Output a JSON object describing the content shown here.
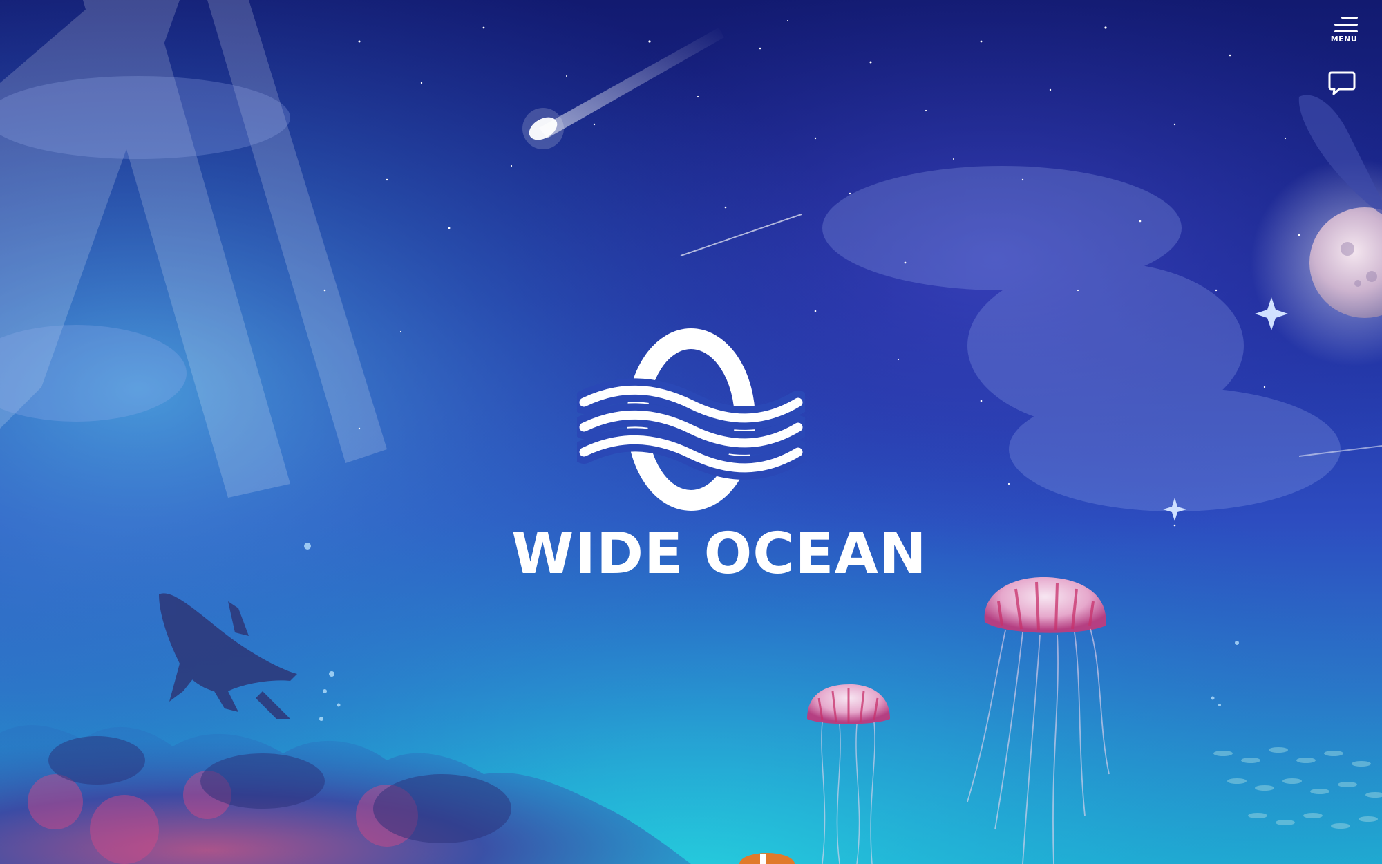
{
  "brand": {
    "name": "WIDE OCEAN",
    "color": "#ffffff"
  },
  "header": {
    "menu_label": "MENU",
    "menu_icon": "hamburger-menu-icon",
    "chat_icon": "chat-bubble-icon"
  },
  "theme": {
    "sky_top": "#13196b",
    "sky_mid": "#2b3fb8",
    "water": "#1fa6d0",
    "jellyfish": "#c8316b"
  }
}
